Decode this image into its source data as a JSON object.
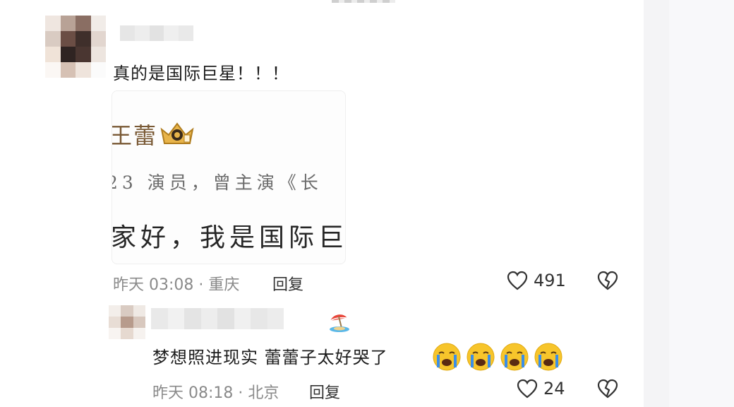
{
  "comments": [
    {
      "text": "真的是国际巨星！！！",
      "quote": {
        "name": "王蕾",
        "bio": "23 演员，曾主演《长",
        "body": "家好，我是国际巨"
      },
      "meta": "昨天 03:08 · 重庆",
      "reply_label": "回复",
      "likes": "491"
    },
    {
      "text": "梦想照进现实 蕾蕾子太好哭了",
      "emojis": [
        "crying-face",
        "crying-face",
        "crying-face",
        "crying-face"
      ],
      "meta": "昨天 08:18 · 北京",
      "reply_label": "回复",
      "likes": "24"
    }
  ],
  "colors": {
    "text": "#1c1c1c",
    "meta": "#8a8a8a",
    "crown": "#d9a23a",
    "emoji": "#f7c52b",
    "tears": "#3b8ee8"
  },
  "icons": [
    "heart-outline-icon",
    "broken-heart-icon",
    "crown-icon",
    "crying-face-icon",
    "beach-umbrella-icon"
  ]
}
